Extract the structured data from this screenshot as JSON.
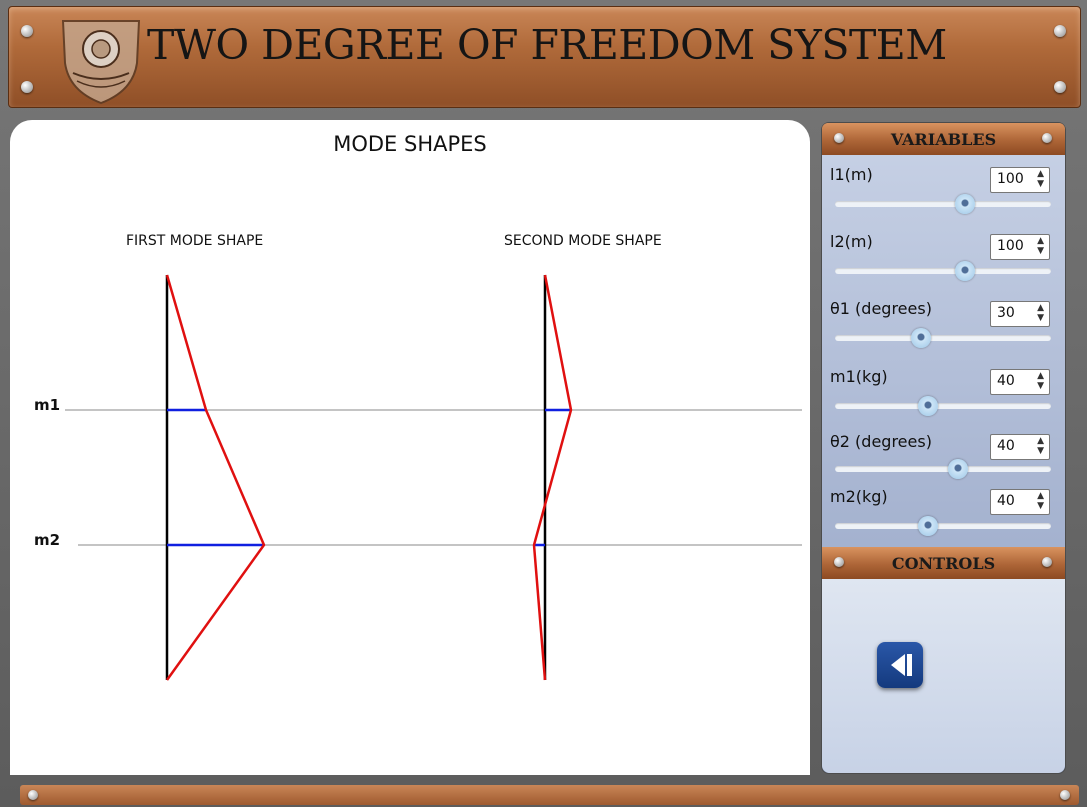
{
  "header": {
    "title": "TWO DEGREE OF FREEDOM SYSTEM"
  },
  "main": {
    "heading": "MODE SHAPES",
    "first_mode_label": "FIRST MODE SHAPE",
    "second_mode_label": "SECOND MODE SHAPE",
    "mass_labels": [
      "m1",
      "m2"
    ]
  },
  "variables_panel": {
    "title": "VARIABLES",
    "items": [
      {
        "label": "l1(m)",
        "value": "100",
        "slider_fraction": 0.6
      },
      {
        "label": "l2(m)",
        "value": "100",
        "slider_fraction": 0.6
      },
      {
        "label": "θ1 (degrees)",
        "value": "30",
        "slider_fraction": 0.4
      },
      {
        "label": "m1(kg)",
        "value": "40",
        "slider_fraction": 0.43
      },
      {
        "label": "θ2 (degrees)",
        "value": "40",
        "slider_fraction": 0.57
      },
      {
        "label": "m2(kg)",
        "value": "40",
        "slider_fraction": 0.43
      }
    ]
  },
  "controls_panel": {
    "title": "CONTROLS",
    "back_icon": "step-back-icon"
  },
  "colors": {
    "shape_line": "#e01010",
    "displacement": "#1020e0",
    "wood": "#b06a3a",
    "panel": "#a9b6d2"
  }
}
